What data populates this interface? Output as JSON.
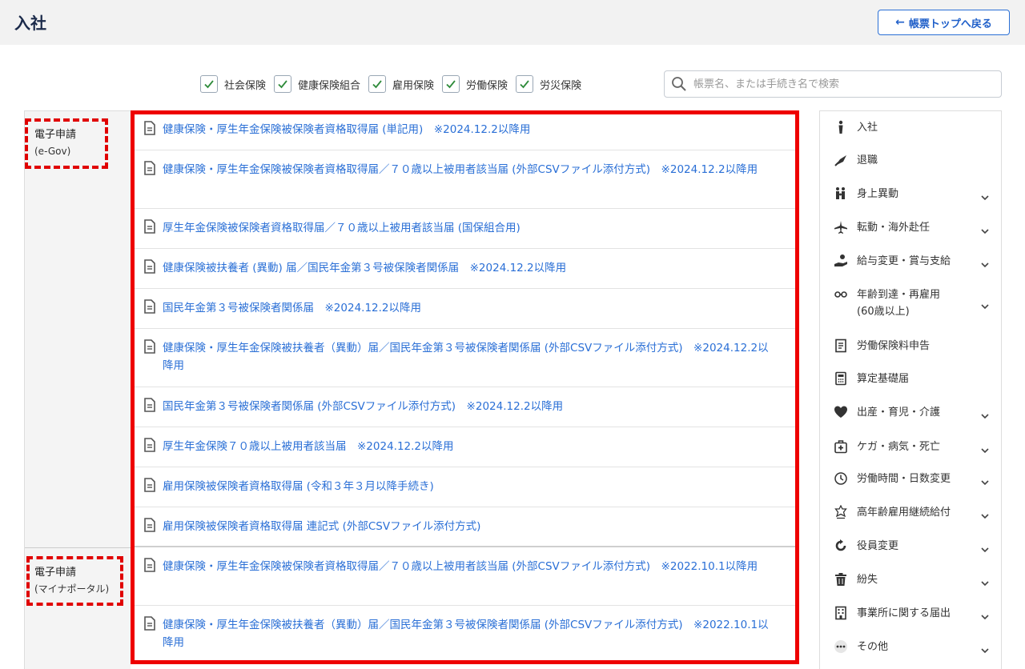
{
  "header": {
    "title": "入社",
    "back_label": "帳票トップへ戻る",
    "back_arrow": "←"
  },
  "filters": [
    {
      "label": "社会保険",
      "checked": true
    },
    {
      "label": "健康保険組合",
      "checked": true
    },
    {
      "label": "雇用保険",
      "checked": true
    },
    {
      "label": "労働保険",
      "checked": true
    },
    {
      "label": "労災保険",
      "checked": true
    }
  ],
  "search": {
    "placeholder": "帳票名、または手続き名で検索",
    "value": ""
  },
  "sections": [
    {
      "label": "電子申請",
      "sub": "(e-Gov)"
    },
    {
      "label": "電子申請",
      "sub": "(マイナポータル)"
    }
  ],
  "rows": [
    {
      "text": "健康保険・厚生年金保険被保険者資格取得届 (単記用)　※2024.12.2以降用"
    },
    {
      "text": "健康保険・厚生年金保険被保険者資格取得届／７０歳以上被用者該当届 (外部CSVファイル添付方式)　※2024.12.2以降用"
    },
    {
      "text": "厚生年金保険被保険者資格取得届／７０歳以上被用者該当届 (国保組合用)"
    },
    {
      "text": "健康保険被扶養者 (異動) 届／国民年金第３号被保険者関係届　※2024.12.2以降用"
    },
    {
      "text": "国民年金第３号被保険者関係届　※2024.12.2以降用"
    },
    {
      "text": "健康保険・厚生年金保険被扶養者（異動）届／国民年金第３号被保険者関係届 (外部CSVファイル添付方式)　※2024.12.2以降用"
    },
    {
      "text": "国民年金第３号被保険者関係届 (外部CSVファイル添付方式)　※2024.12.2以降用"
    },
    {
      "text": "厚生年金保険７０歳以上被用者該当届　※2024.12.2以降用"
    },
    {
      "text": "雇用保険被保険者資格取得届 (令和３年３月以降手続き)"
    },
    {
      "text": "雇用保険被保険者資格取得届 連記式 (外部CSVファイル添付方式)"
    },
    {
      "text": "健康保険・厚生年金保険被保険者資格取得届／７０歳以上被用者該当届 (外部CSVファイル添付方式)　※2022.10.1以降用"
    },
    {
      "text": "健康保険・厚生年金保険被扶養者（異動）届／国民年金第３号被保険者関係届 (外部CSVファイル添付方式)　※2022.10.1以降用"
    }
  ],
  "sidebar": [
    {
      "label": "入社",
      "icon": "person-icon",
      "expandable": false
    },
    {
      "label": "退職",
      "icon": "leaving-icon",
      "expandable": false
    },
    {
      "label": "身上異動",
      "icon": "family-icon",
      "expandable": true
    },
    {
      "label": "転動・海外赴任",
      "icon": "airplane-icon",
      "expandable": true
    },
    {
      "label": "給与変更・賞与支給",
      "icon": "money-hand-icon",
      "expandable": true
    },
    {
      "label": "年齢到達・再雇用\n(60歳以上)",
      "icon": "glasses-icon",
      "expandable": true
    },
    {
      "label": "労働保険料申告",
      "icon": "document-icon",
      "expandable": false
    },
    {
      "label": "算定基礎届",
      "icon": "calculator-icon",
      "expandable": false
    },
    {
      "label": "出産・育児・介護",
      "icon": "heart-icon",
      "expandable": true
    },
    {
      "label": "ケガ・病気・死亡",
      "icon": "first-aid-icon",
      "expandable": true
    },
    {
      "label": "労働時間・日数変更",
      "icon": "clock-icon",
      "expandable": true
    },
    {
      "label": "高年齢雇用継続給付",
      "icon": "badge-icon",
      "expandable": true
    },
    {
      "label": "役員変更",
      "icon": "refresh-icon",
      "expandable": true
    },
    {
      "label": "紛失",
      "icon": "trash-icon",
      "expandable": true
    },
    {
      "label": "事業所に関する届出",
      "icon": "building-icon",
      "expandable": true
    },
    {
      "label": "その他",
      "icon": "more-icon",
      "expandable": true
    }
  ]
}
